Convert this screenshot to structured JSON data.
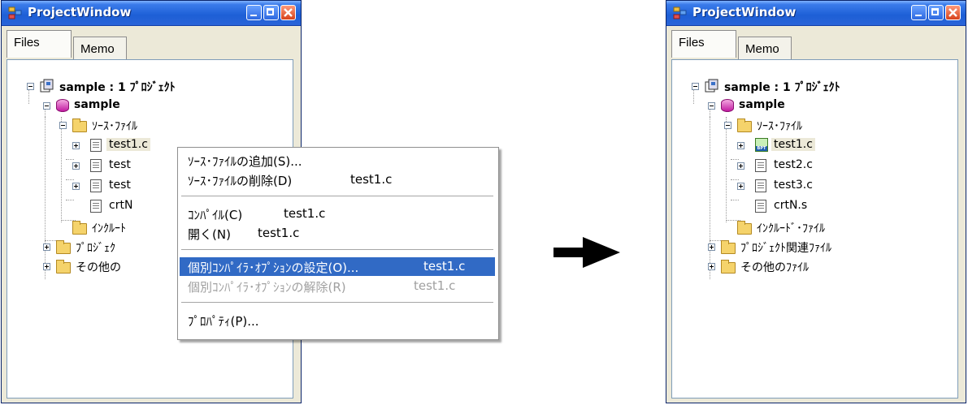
{
  "left_window": {
    "title": "ProjectWindow",
    "tabs": [
      {
        "label": "Files"
      },
      {
        "label": "Memo"
      }
    ],
    "tree": {
      "project": "sample : 1 ﾌﾟﾛｼﾞｪｸﾄ",
      "subproject": "sample",
      "source_folder": "ｿｰｽ･ﾌｧｲﾙ",
      "files": [
        "test1.c",
        "test",
        "test",
        "crtN"
      ],
      "include_folder": "ｲﾝｸﾙｰﾄ",
      "project_folder": "ﾌﾟﾛｼﾞｪｸ",
      "other_folder": "その他の"
    }
  },
  "context_menu": {
    "items": [
      {
        "label": "ｿｰｽ･ﾌｧｲﾙの追加(S)...",
        "target": ""
      },
      {
        "label": "ｿｰｽ･ﾌｧｲﾙの削除(D)",
        "target": "test1.c"
      },
      {
        "label": "ｺﾝﾊﾟｲﾙ(C)",
        "target": "test1.c"
      },
      {
        "label": "開く(N)",
        "target": "test1.c"
      },
      {
        "label": "個別ｺﾝﾊﾟｲﾗ･ｵﾌﾟｼｮﾝの設定(O)...",
        "target": "test1.c"
      },
      {
        "label": "個別ｺﾝﾊﾟｲﾗ･ｵﾌﾟｼｮﾝの解除(R)",
        "target": "test1.c"
      },
      {
        "label": "ﾌﾟﾛﾊﾟﾃｨ(P)...",
        "target": ""
      }
    ]
  },
  "right_window": {
    "title": "ProjectWindow",
    "tabs": [
      {
        "label": "Files"
      },
      {
        "label": "Memo"
      }
    ],
    "tree": {
      "project": "sample : 1 ﾌﾟﾛｼﾞｪｸﾄ",
      "subproject": "sample",
      "source_folder": "ｿｰｽ･ﾌｧｲﾙ",
      "files": [
        "test1.c",
        "test2.c",
        "test3.c",
        "crtN.s"
      ],
      "bpt_badge": "BPT",
      "include_folder": "ｲﾝｸﾙｰﾄﾞ･ﾌｧｲﾙ",
      "project_folder": "ﾌﾟﾛｼﾞｪｸﾄ関連ﾌｧｲﾙ",
      "other_folder": "その他のﾌｧｲﾙ"
    }
  },
  "colors": {
    "titlebar": "#1d5fd6",
    "menu_highlight": "#316ac5",
    "window_bg": "#ece9d8"
  }
}
